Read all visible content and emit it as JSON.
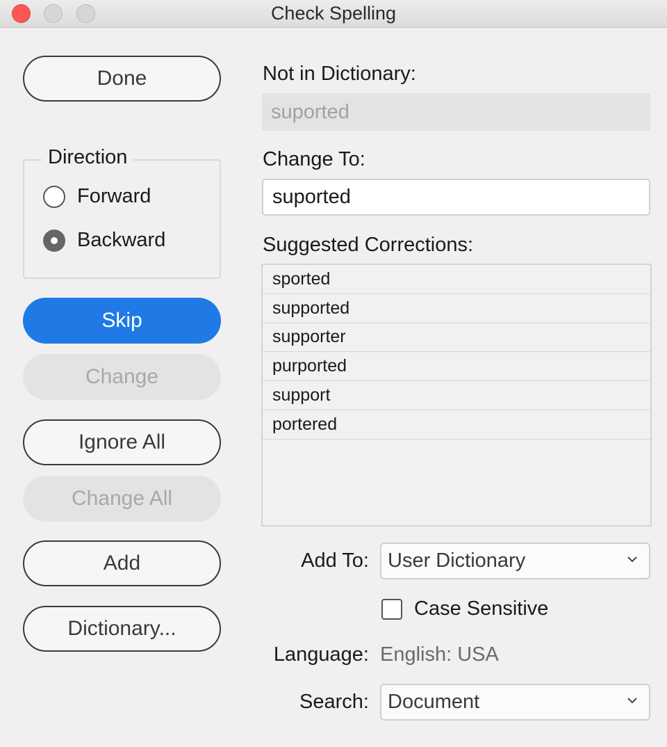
{
  "window": {
    "title": "Check Spelling"
  },
  "buttons": {
    "done": "Done",
    "skip": "Skip",
    "change": "Change",
    "ignore_all": "Ignore All",
    "change_all": "Change All",
    "add": "Add",
    "dictionary": "Dictionary..."
  },
  "direction": {
    "legend": "Direction",
    "options": [
      {
        "label": "Forward",
        "selected": false
      },
      {
        "label": "Backward",
        "selected": true
      }
    ]
  },
  "not_in_dictionary": {
    "label": "Not in Dictionary:",
    "value": "suported"
  },
  "change_to": {
    "label": "Change To:",
    "value": "suported"
  },
  "suggestions": {
    "label": "Suggested Corrections:",
    "items": [
      "sported",
      "supported",
      "supporter",
      "purported",
      "support",
      "portered"
    ]
  },
  "add_to": {
    "label": "Add To:",
    "value": "User Dictionary"
  },
  "case_sensitive": {
    "label": "Case Sensitive",
    "checked": false
  },
  "language": {
    "label": "Language:",
    "value": "English: USA"
  },
  "search": {
    "label": "Search:",
    "value": "Document"
  },
  "colors": {
    "accent": "#1f7ae6",
    "close": "#fc5753"
  }
}
